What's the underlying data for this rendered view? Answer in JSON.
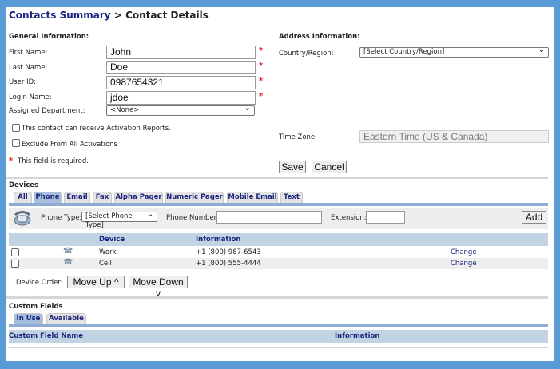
{
  "breadcrumb": {
    "parent": "Contacts Summary",
    "separator": " > ",
    "current": "Contact Details"
  },
  "general": {
    "heading": "General Information:",
    "first_name": {
      "label": "First Name:",
      "value": "John"
    },
    "last_name": {
      "label": "Last Name:",
      "value": "Doe"
    },
    "user_id": {
      "label": "User ID:",
      "value": "0987654321"
    },
    "login_name": {
      "label": "Login Name:",
      "value": "jdoe"
    },
    "department": {
      "label": "Assigned Department:",
      "value": "<None>"
    },
    "activation_reports": "This contact can receive Activation Reports.",
    "exclude_activations": "Exclude From All Activations",
    "required_note": "This field is required.",
    "required_mark": "*"
  },
  "address": {
    "heading": "Address Information:",
    "country_label": "Country/Region:",
    "country_value": "[Select Country/Region]",
    "timezone_label": "Time Zone:",
    "timezone_value": "Eastern Time (US & Canada)"
  },
  "actions": {
    "save": "Save",
    "cancel": "Cancel"
  },
  "devices": {
    "heading": "Devices",
    "tabs": [
      "All",
      "Phone",
      "Email",
      "Fax",
      "Alpha Pager",
      "Numeric Pager",
      "Mobile Email",
      "Text"
    ],
    "active_tab": "Phone",
    "phone_type_label": "Phone Type:",
    "phone_type_value": "[Select Phone Type]",
    "phone_number_label": "Phone Number:",
    "phone_number_value": "",
    "extension_label": "Extension:",
    "extension_value": "",
    "add": "Add",
    "columns": {
      "device": "Device",
      "information": "Information"
    },
    "rows": [
      {
        "device": "Work",
        "information": "+1 (800) 987-6543",
        "action": "Change"
      },
      {
        "device": "Cell",
        "information": "+1 (800) 555-4444",
        "action": "Change"
      }
    ],
    "order_label": "Device Order:",
    "move_up": "Move Up ^",
    "move_down": "Move Down v"
  },
  "custom_fields": {
    "heading": "Custom Fields",
    "tabs": [
      "In Use",
      "Available"
    ],
    "active_tab": "In Use",
    "columns": {
      "name": "Custom Field Name",
      "information": "Information"
    }
  },
  "colors": {
    "border": "#5b9bd5",
    "link": "#1a237e",
    "required": "#e0202a",
    "header": "#c2d4e3"
  }
}
